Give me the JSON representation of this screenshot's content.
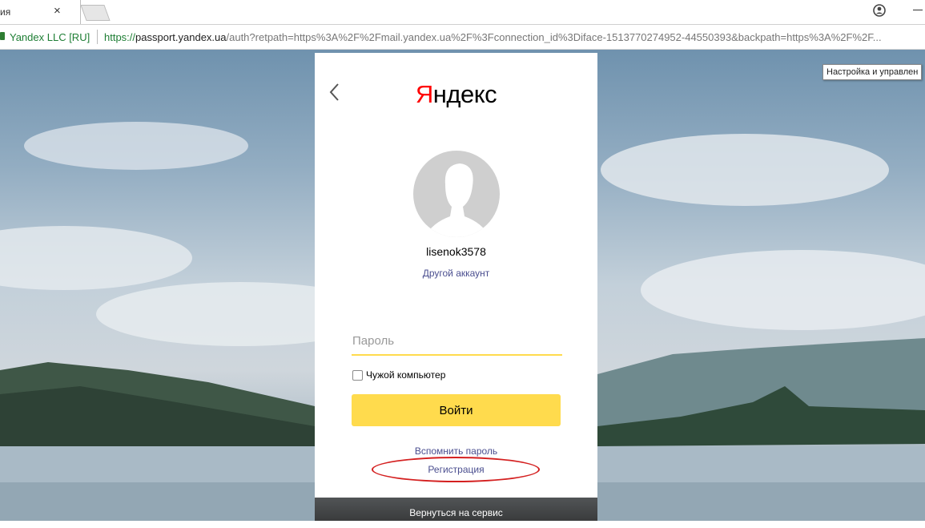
{
  "browser": {
    "tab_title": "ия",
    "tab_close": "×",
    "site_owner": "Yandex LLC [RU]",
    "url_scheme": "https://",
    "url_host": "passport.yandex.ua",
    "url_rest": "/auth?retpath=https%3A%2F%2Fmail.yandex.ua%2F%3Fconnection_id%3Diface-1513770274952-44550393&backpath=https%3A%2F%2F...",
    "tooltip": "Настройка и управлен"
  },
  "card": {
    "logo_first": "Я",
    "logo_rest": "ндекс",
    "username": "lisenok3578",
    "other_account": "Другой аккаунт",
    "password_placeholder": "Пароль",
    "foreign_computer": "Чужой компьютер",
    "login_button": "Войти",
    "remember_password": "Вспомнить пароль",
    "registration": "Регистрация"
  },
  "footer": {
    "return_to_service": "Вернуться на сервис"
  },
  "colors": {
    "accent_yellow": "#ffdb4d",
    "logo_red": "#ff0000",
    "link": "#4a4e8f",
    "annotation_red": "#d42020"
  },
  "icons": [
    "back-arrow-icon",
    "close-icon",
    "profile-icon",
    "lock-icon",
    "avatar-silhouette-icon"
  ]
}
